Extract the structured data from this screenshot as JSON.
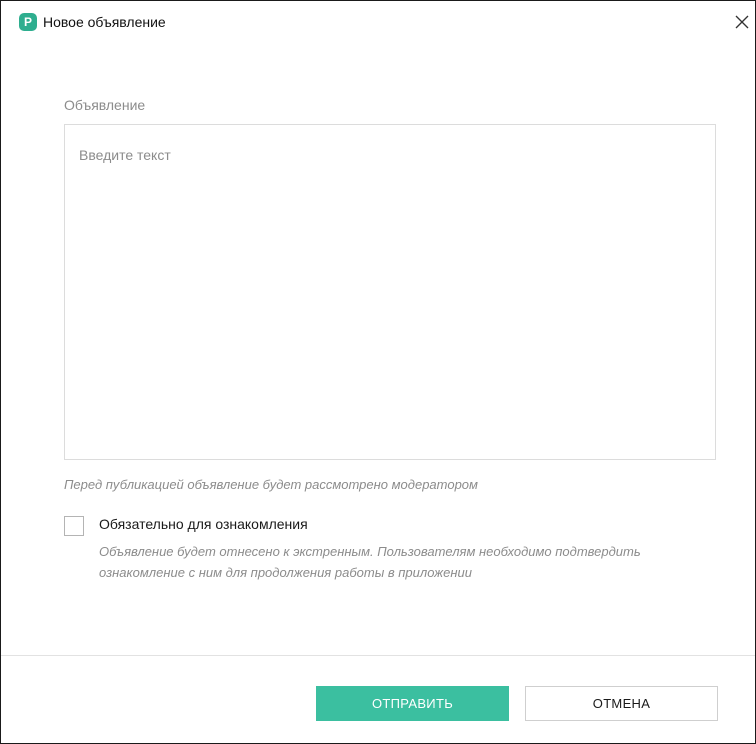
{
  "window": {
    "title": "Новое объявление",
    "app_icon_letter": "P",
    "icon": "close-icon"
  },
  "form": {
    "field_label": "Объявление",
    "textarea_value": "",
    "textarea_placeholder": "Введите текст",
    "moderation_note": "Перед публикацией объявление будет рассмотрено модератором",
    "required_checkbox_checked": false,
    "required_checkbox_label": "Обязательно для ознакомления",
    "required_checkbox_hint": "Объявление будет отнесено к экстренным. Пользователям необходимо подтвердить ознакомление с ним для продолжения работы в приложении"
  },
  "actions": {
    "submit_label": "ОТПРАВИТЬ",
    "cancel_label": "ОТМЕНА"
  },
  "colors": {
    "accent": "#3bbfa0",
    "app_icon": "#2eae8f"
  }
}
